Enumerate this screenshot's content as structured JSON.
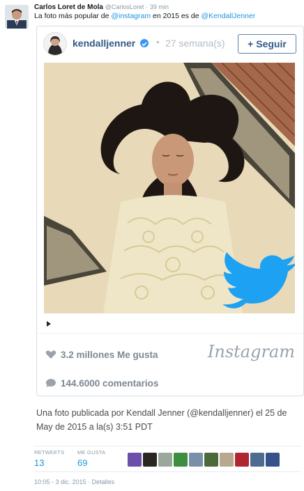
{
  "tweet": {
    "author_name": "Carlos Loret de Mola",
    "author_handle": "@CarlosLoret",
    "separator": "·",
    "time_ago": "39 min",
    "text_prefix": "La foto más popular de ",
    "mention_1": "@instagram",
    "text_middle": " en 2015 es de ",
    "mention_2": "@KendallJenner"
  },
  "embed": {
    "username": "kendalljenner",
    "separator": "•",
    "age": "27 semana(s)",
    "follow_label": "+ Seguir",
    "likes": "3.2 millones Me gusta",
    "logo": "Instagram",
    "comments": "144.6000 comentarios",
    "icons": [
      "heart-icon",
      "comment-icon",
      "verified-icon",
      "next-arrow-icon",
      "twitter-bird-icon"
    ]
  },
  "caption": "Una foto publicada por Kendall Jenner (@kendalljenner) el 25 de May de 2015 a la(s) 3:51 PDT",
  "stats": {
    "retweets_label": "RETWEETS",
    "retweets": "13",
    "likes_label": "ME GUSTA",
    "likes": "69"
  },
  "footer": {
    "timestamp": "10:05 - 3 dic. 2015",
    "separator": "·",
    "details": "Detalles"
  },
  "colors": {
    "link": "#1b95e0",
    "ig_user": "#325a8b",
    "twitter_bird": "#1da1f2"
  }
}
